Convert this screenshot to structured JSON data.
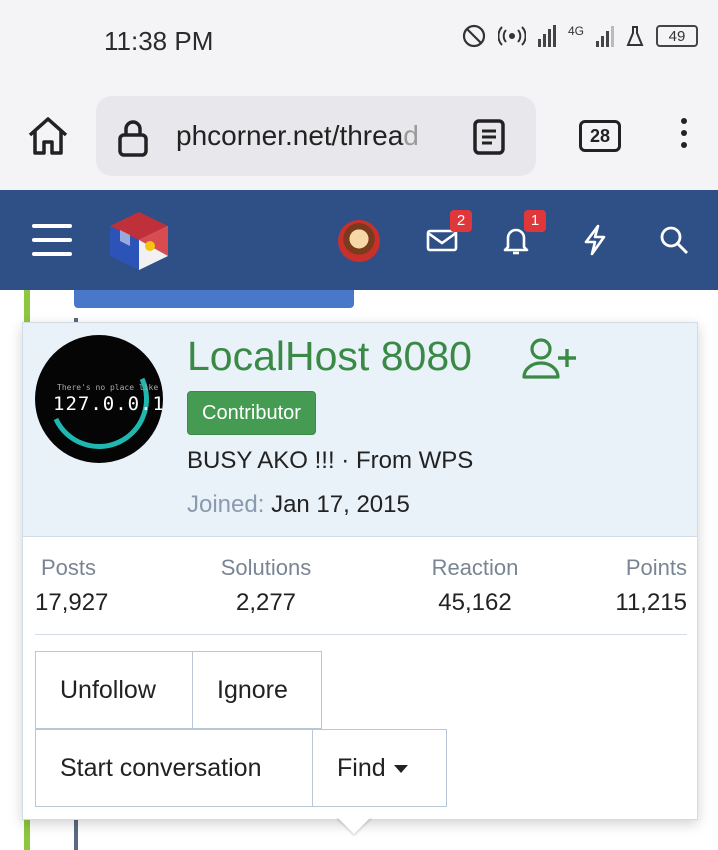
{
  "status_bar": {
    "time": "11:38 PM",
    "network": "4G",
    "battery": "49"
  },
  "browser": {
    "url": "phcorner.net/threa",
    "url_faded": "d",
    "tab_count": "28"
  },
  "header": {
    "mail_badge": "2",
    "alerts_badge": "1",
    "colors": {
      "bar": "#2f5086",
      "badge": "#e0373b"
    }
  },
  "profile": {
    "avatar_text_small": "There's no place like",
    "avatar_text_ip": "127.0.0.1",
    "username": "LocalHost 8080",
    "role": "Contributor",
    "status": "BUSY AKO !!! · From WPS",
    "joined_label": "Joined:",
    "joined_value": "Jan 17, 2015",
    "colors": {
      "username": "#3a8a46",
      "role_bg": "#459b52"
    }
  },
  "stats": [
    {
      "label": "Posts",
      "value": "17,927"
    },
    {
      "label": "Solutions",
      "value": "2,277"
    },
    {
      "label": "Reaction",
      "value": "45,162"
    },
    {
      "label": "Points",
      "value": "11,215"
    }
  ],
  "actions": {
    "unfollow": "Unfollow",
    "ignore": "Ignore",
    "start_conversation": "Start conversation",
    "find": "Find"
  }
}
